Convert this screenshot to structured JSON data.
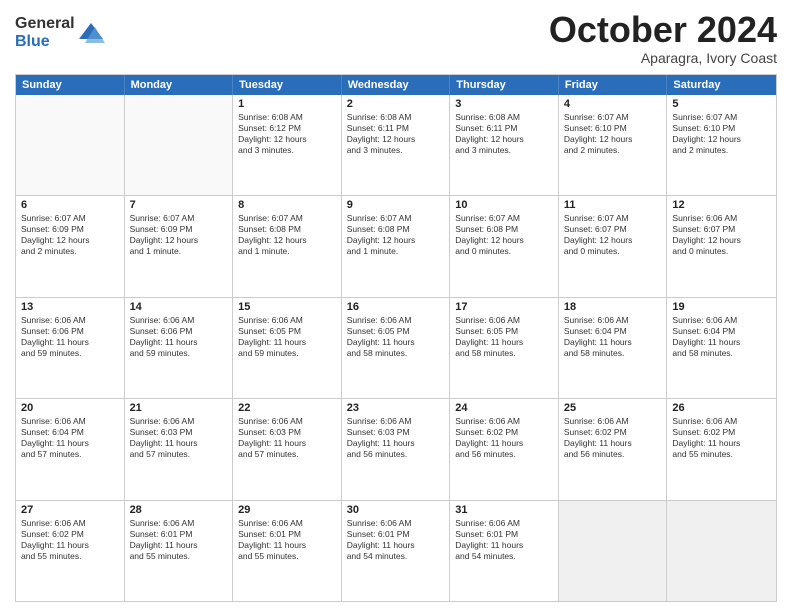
{
  "logo": {
    "general": "General",
    "blue": "Blue"
  },
  "title": "October 2024",
  "location": "Aparagra, Ivory Coast",
  "header_days": [
    "Sunday",
    "Monday",
    "Tuesday",
    "Wednesday",
    "Thursday",
    "Friday",
    "Saturday"
  ],
  "rows": [
    [
      {
        "day": "",
        "info": "",
        "empty": true
      },
      {
        "day": "",
        "info": "",
        "empty": true
      },
      {
        "day": "1",
        "info": "Sunrise: 6:08 AM\nSunset: 6:12 PM\nDaylight: 12 hours\nand 3 minutes."
      },
      {
        "day": "2",
        "info": "Sunrise: 6:08 AM\nSunset: 6:11 PM\nDaylight: 12 hours\nand 3 minutes."
      },
      {
        "day": "3",
        "info": "Sunrise: 6:08 AM\nSunset: 6:11 PM\nDaylight: 12 hours\nand 3 minutes."
      },
      {
        "day": "4",
        "info": "Sunrise: 6:07 AM\nSunset: 6:10 PM\nDaylight: 12 hours\nand 2 minutes."
      },
      {
        "day": "5",
        "info": "Sunrise: 6:07 AM\nSunset: 6:10 PM\nDaylight: 12 hours\nand 2 minutes."
      }
    ],
    [
      {
        "day": "6",
        "info": "Sunrise: 6:07 AM\nSunset: 6:09 PM\nDaylight: 12 hours\nand 2 minutes."
      },
      {
        "day": "7",
        "info": "Sunrise: 6:07 AM\nSunset: 6:09 PM\nDaylight: 12 hours\nand 1 minute."
      },
      {
        "day": "8",
        "info": "Sunrise: 6:07 AM\nSunset: 6:08 PM\nDaylight: 12 hours\nand 1 minute."
      },
      {
        "day": "9",
        "info": "Sunrise: 6:07 AM\nSunset: 6:08 PM\nDaylight: 12 hours\nand 1 minute."
      },
      {
        "day": "10",
        "info": "Sunrise: 6:07 AM\nSunset: 6:08 PM\nDaylight: 12 hours\nand 0 minutes."
      },
      {
        "day": "11",
        "info": "Sunrise: 6:07 AM\nSunset: 6:07 PM\nDaylight: 12 hours\nand 0 minutes."
      },
      {
        "day": "12",
        "info": "Sunrise: 6:06 AM\nSunset: 6:07 PM\nDaylight: 12 hours\nand 0 minutes."
      }
    ],
    [
      {
        "day": "13",
        "info": "Sunrise: 6:06 AM\nSunset: 6:06 PM\nDaylight: 11 hours\nand 59 minutes."
      },
      {
        "day": "14",
        "info": "Sunrise: 6:06 AM\nSunset: 6:06 PM\nDaylight: 11 hours\nand 59 minutes."
      },
      {
        "day": "15",
        "info": "Sunrise: 6:06 AM\nSunset: 6:05 PM\nDaylight: 11 hours\nand 59 minutes."
      },
      {
        "day": "16",
        "info": "Sunrise: 6:06 AM\nSunset: 6:05 PM\nDaylight: 11 hours\nand 58 minutes."
      },
      {
        "day": "17",
        "info": "Sunrise: 6:06 AM\nSunset: 6:05 PM\nDaylight: 11 hours\nand 58 minutes."
      },
      {
        "day": "18",
        "info": "Sunrise: 6:06 AM\nSunset: 6:04 PM\nDaylight: 11 hours\nand 58 minutes."
      },
      {
        "day": "19",
        "info": "Sunrise: 6:06 AM\nSunset: 6:04 PM\nDaylight: 11 hours\nand 58 minutes."
      }
    ],
    [
      {
        "day": "20",
        "info": "Sunrise: 6:06 AM\nSunset: 6:04 PM\nDaylight: 11 hours\nand 57 minutes."
      },
      {
        "day": "21",
        "info": "Sunrise: 6:06 AM\nSunset: 6:03 PM\nDaylight: 11 hours\nand 57 minutes."
      },
      {
        "day": "22",
        "info": "Sunrise: 6:06 AM\nSunset: 6:03 PM\nDaylight: 11 hours\nand 57 minutes."
      },
      {
        "day": "23",
        "info": "Sunrise: 6:06 AM\nSunset: 6:03 PM\nDaylight: 11 hours\nand 56 minutes."
      },
      {
        "day": "24",
        "info": "Sunrise: 6:06 AM\nSunset: 6:02 PM\nDaylight: 11 hours\nand 56 minutes."
      },
      {
        "day": "25",
        "info": "Sunrise: 6:06 AM\nSunset: 6:02 PM\nDaylight: 11 hours\nand 56 minutes."
      },
      {
        "day": "26",
        "info": "Sunrise: 6:06 AM\nSunset: 6:02 PM\nDaylight: 11 hours\nand 55 minutes."
      }
    ],
    [
      {
        "day": "27",
        "info": "Sunrise: 6:06 AM\nSunset: 6:02 PM\nDaylight: 11 hours\nand 55 minutes."
      },
      {
        "day": "28",
        "info": "Sunrise: 6:06 AM\nSunset: 6:01 PM\nDaylight: 11 hours\nand 55 minutes."
      },
      {
        "day": "29",
        "info": "Sunrise: 6:06 AM\nSunset: 6:01 PM\nDaylight: 11 hours\nand 55 minutes."
      },
      {
        "day": "30",
        "info": "Sunrise: 6:06 AM\nSunset: 6:01 PM\nDaylight: 11 hours\nand 54 minutes."
      },
      {
        "day": "31",
        "info": "Sunrise: 6:06 AM\nSunset: 6:01 PM\nDaylight: 11 hours\nand 54 minutes."
      },
      {
        "day": "",
        "info": "",
        "empty": true,
        "shaded": true
      },
      {
        "day": "",
        "info": "",
        "empty": true,
        "shaded": true
      }
    ]
  ]
}
